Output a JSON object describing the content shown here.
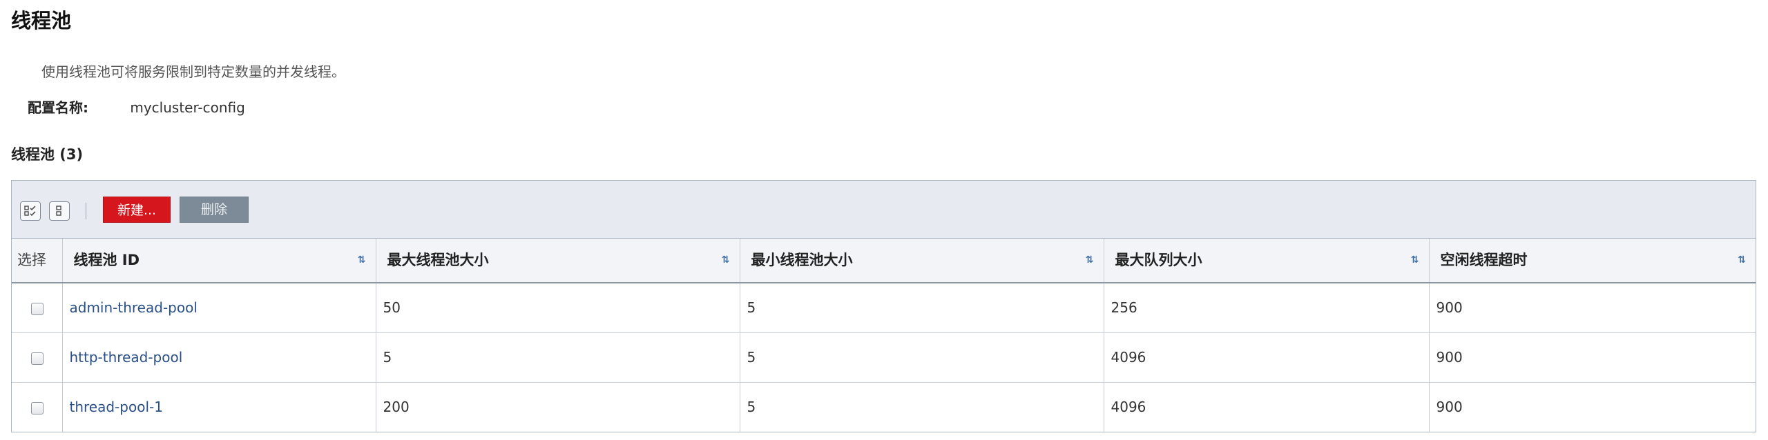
{
  "page": {
    "title": "线程池",
    "description": "使用线程池可将服务限制到特定数量的并发线程。",
    "config_label": "配置名称:",
    "config_value": "mycluster-config"
  },
  "section": {
    "title": "线程池 (3)"
  },
  "toolbar": {
    "new_label": "新建...",
    "delete_label": "删除",
    "new_color": "#d6161d",
    "delete_color": "#7d8b98"
  },
  "table": {
    "columns": [
      "选择",
      "线程池 ID",
      "最大线程池大小",
      "最小线程池大小",
      "最大队列大小",
      "空闲线程超时"
    ],
    "rows": [
      {
        "id": "admin-thread-pool",
        "max_pool": "50",
        "min_pool": "5",
        "max_queue": "256",
        "idle_timeout": "900"
      },
      {
        "id": "http-thread-pool",
        "max_pool": "5",
        "min_pool": "5",
        "max_queue": "4096",
        "idle_timeout": "900"
      },
      {
        "id": "thread-pool-1",
        "max_pool": "200",
        "min_pool": "5",
        "max_queue": "4096",
        "idle_timeout": "900"
      }
    ]
  }
}
